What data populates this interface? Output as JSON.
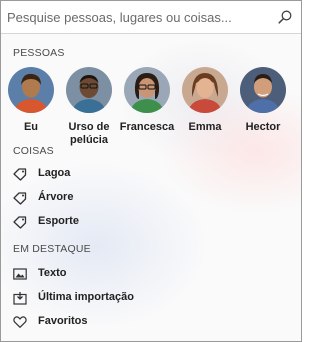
{
  "search": {
    "placeholder": "Pesquise pessoas, lugares ou coisas..."
  },
  "people": {
    "title": "PESSOAS",
    "items": [
      {
        "name": "Eu",
        "skin": "#b07a4f",
        "hair": "#3a2414",
        "bg": "#5b7fa8",
        "shirt": "#d8572e"
      },
      {
        "name": "Urso de pelúcia",
        "skin": "#6d4a34",
        "hair": "#1e140e",
        "bg": "#7d8fa3",
        "shirt": "#3a6f96"
      },
      {
        "name": "Francesca",
        "skin": "#c99574",
        "hair": "#2a1c12",
        "bg": "#9aa7b7",
        "shirt": "#3e8f4b"
      },
      {
        "name": "Emma",
        "skin": "#e4b391",
        "hair": "#6b3d20",
        "bg": "#c9a892",
        "shirt": "#c84a3a"
      },
      {
        "name": "Hector",
        "skin": "#d19e7b",
        "hair": "#2b1e17",
        "bg": "#4d5e7a",
        "shirt": "#4f6fa8"
      }
    ]
  },
  "things": {
    "title": "COISAS",
    "items": [
      {
        "label": "Lagoa",
        "icon": "tag-icon"
      },
      {
        "label": "Árvore",
        "icon": "tag-icon"
      },
      {
        "label": "Esporte",
        "icon": "tag-icon"
      }
    ]
  },
  "featured": {
    "title": "EM DESTAQUE",
    "items": [
      {
        "label": "Texto",
        "icon": "image-text-icon"
      },
      {
        "label": "Última importação",
        "icon": "import-icon"
      },
      {
        "label": "Favoritos",
        "icon": "heart-icon"
      }
    ]
  }
}
